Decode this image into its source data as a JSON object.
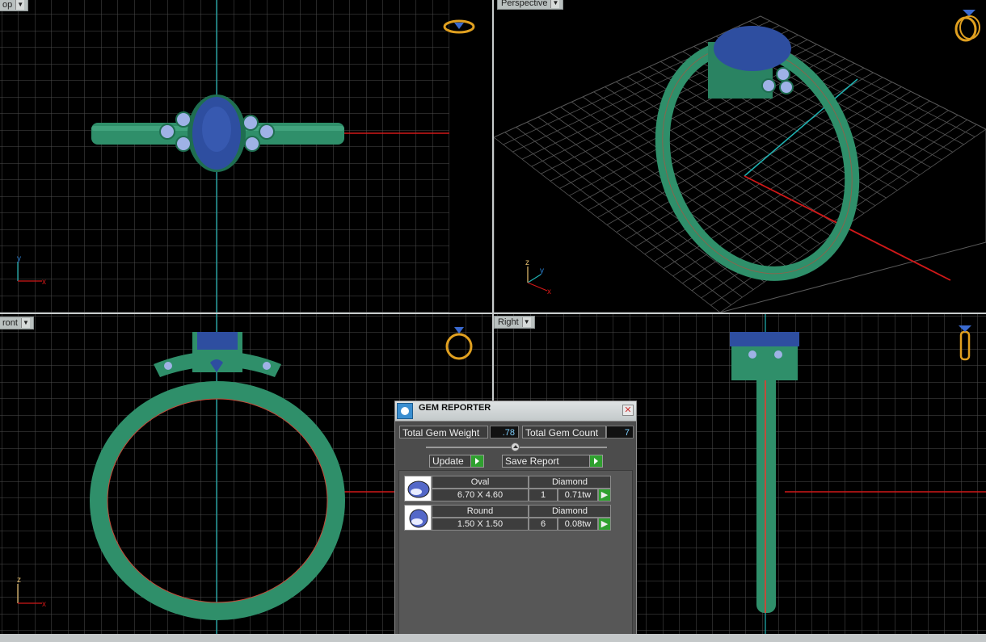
{
  "viewports": {
    "top": {
      "label": "op"
    },
    "perspective": {
      "label": "Perspective"
    },
    "front": {
      "label": "ront"
    },
    "right": {
      "label": "Right"
    }
  },
  "axes": {
    "x": "x",
    "y": "y",
    "z": "z"
  },
  "colors": {
    "metal": "#2f8f6a",
    "gem_center": "#2e4ea0",
    "gem_side": "#9fb2e6",
    "grid": "#6b6b6b",
    "axis_x": "#d01818",
    "axis_y": "#1fb4b4"
  },
  "gem_reporter": {
    "title": "GEM REPORTER",
    "total_weight_label": "Total Gem Weight",
    "total_weight_value": ".78",
    "total_count_label": "Total Gem Count",
    "total_count_value": "7",
    "update_label": "Update",
    "save_report_label": "Save Report",
    "gems": [
      {
        "shape": "Oval",
        "material": "Diamond",
        "size": "6.70 X 4.60",
        "count": "1",
        "weight": "0.71tw"
      },
      {
        "shape": "Round",
        "material": "Diamond",
        "size": "1.50 X 1.50",
        "count": "6",
        "weight": "0.08tw"
      }
    ]
  }
}
